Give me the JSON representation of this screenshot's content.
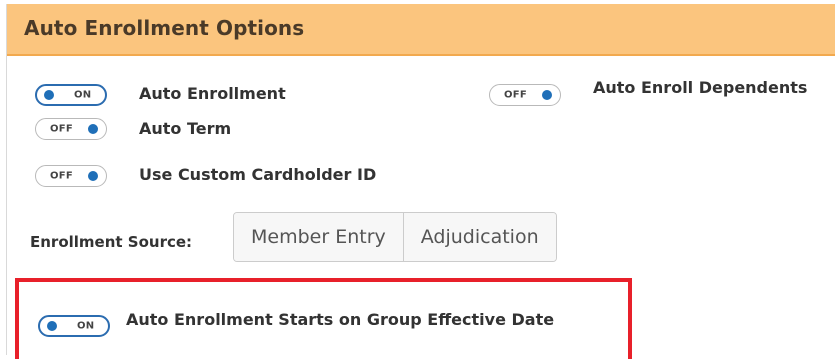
{
  "panel": {
    "title": "Auto Enrollment Options"
  },
  "toggles": {
    "auto_enrollment": {
      "label": "Auto Enrollment",
      "state": "ON",
      "enabled": true
    },
    "auto_term": {
      "label": "Auto Term",
      "state": "OFF",
      "enabled": false
    },
    "custom_cardholder_id": {
      "label": "Use Custom Cardholder ID",
      "state": "OFF",
      "enabled": false
    },
    "auto_enroll_dependents": {
      "label": "Auto Enroll Dependents",
      "state": "OFF",
      "enabled": false
    },
    "starts_on_group_effective_date": {
      "label": "Auto Enrollment Starts on Group Effective Date",
      "state": "ON",
      "enabled": true
    }
  },
  "enrollment_source": {
    "label": "Enrollment Source:",
    "options": [
      "Member Entry",
      "Adjudication"
    ]
  },
  "colors": {
    "header_bg": "#fbc57e",
    "accent_blue": "#1f6fb8",
    "highlight_red": "#e8202a"
  },
  "icons": {
    "toggle_knob": "toggle-knob-icon"
  }
}
